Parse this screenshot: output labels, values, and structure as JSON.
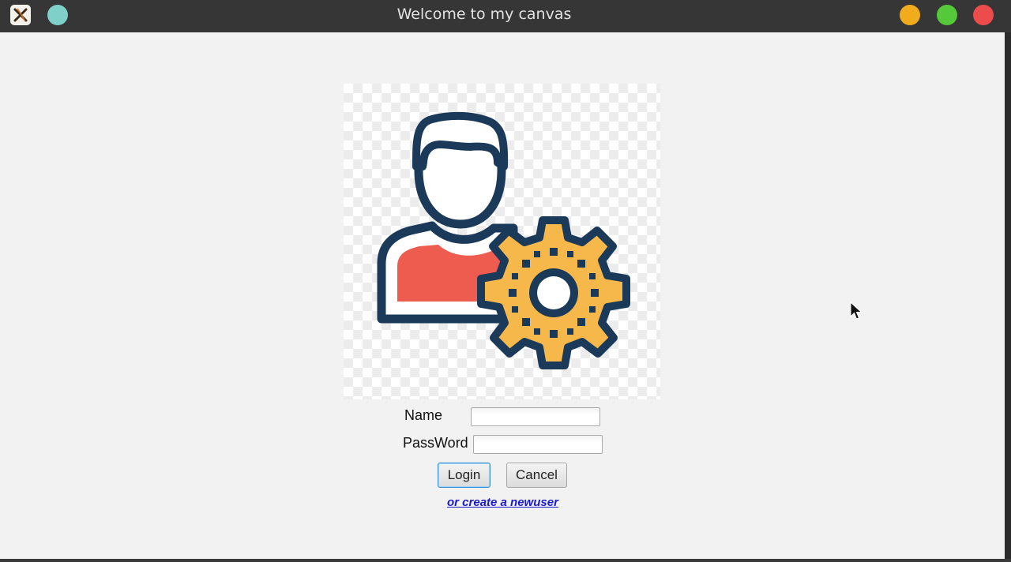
{
  "window": {
    "title": "Welcome to my canvas"
  },
  "titlebar_controls": {
    "app_icon": "app-logo-icon",
    "extra_button": "teal-circle-button",
    "minimize": "minimize-button",
    "maximize": "maximize-button",
    "close": "close-button",
    "colors": {
      "teal": "#7fd0c8",
      "minimize": "#f0ac1d",
      "maximize": "#55c93a",
      "close": "#ec4c4b"
    }
  },
  "logo": {
    "icon": "user-gear-icon",
    "colors": {
      "outline": "#1b3a5a",
      "shirt": "#ee5b4f",
      "gear": "#f7b84b"
    }
  },
  "form": {
    "name_label": "Name",
    "name_value": "",
    "password_label": "PassWord",
    "password_value": "",
    "login_label": "Login",
    "cancel_label": "Cancel",
    "create_user_link": "or create a newuser"
  }
}
